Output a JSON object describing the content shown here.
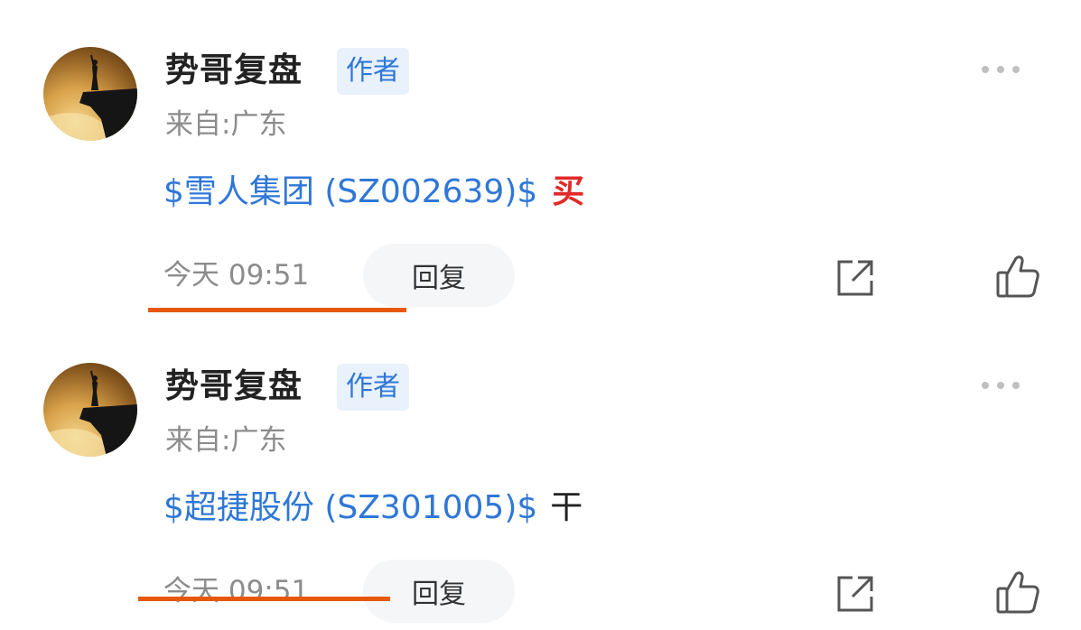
{
  "comments": [
    {
      "username": "势哥复盘",
      "badge": "作者",
      "location": "来自:广东",
      "stock_link": "$雪人集团 (SZ002639)$",
      "action_tag": "买",
      "timestamp": "今天 09:51",
      "reply_label": "回复"
    },
    {
      "username": "势哥复盘",
      "badge": "作者",
      "location": "来自:广东",
      "stock_link": "$超捷股份 (SZ301005)$",
      "action_tag": "干",
      "timestamp": "今天 09:51",
      "reply_label": "回复"
    }
  ],
  "colors": {
    "link": "#2f77d7",
    "badge_bg": "#e8f1fc",
    "buy_tag": "#e02a2a",
    "annotation_underline": "#e6590a",
    "muted_text": "#8c8c8c"
  },
  "icons": [
    "more-icon",
    "share-icon",
    "like-icon"
  ]
}
